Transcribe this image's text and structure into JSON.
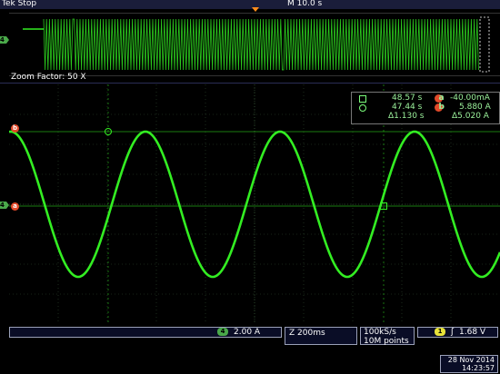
{
  "header": {
    "brand": "Tek",
    "state": "Stop",
    "horizontal_scale": "M 10.0 s"
  },
  "zoom": {
    "label": "Zoom Factor: 50 X"
  },
  "channels": {
    "ch4_label": "4",
    "cursor_a": "a",
    "cursor_b": "b"
  },
  "cursor_readout": {
    "t1": "48.57 s",
    "v1": "-40.00mA",
    "t2": "47.44 s",
    "v2": "5.880 A",
    "dt": "Δ1.130 s",
    "dv": "Δ5.020 A"
  },
  "status": {
    "ch4_scale": "2.00 A",
    "zoom_timebase": "Z 200ms",
    "sample_rate": "100kS/s",
    "record_length": "10M points",
    "trigger_source": "1",
    "trigger_slope": "ʃ",
    "trigger_level": "1.68 V",
    "date": "28 Nov 2014",
    "time": "14:23:57"
  },
  "colors": {
    "trace": "#33ee22",
    "cursor": "#e34a2a",
    "ch4": "#4aa94a",
    "grid": "#2e4a2e",
    "bar": "#0a0d26"
  }
}
